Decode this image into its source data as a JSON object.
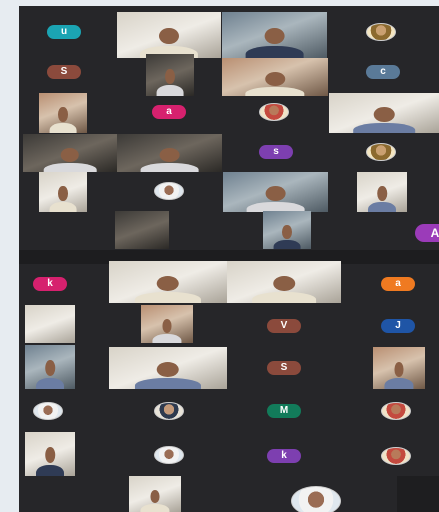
{
  "colors": {
    "background": "#e7ecf1",
    "grid": "#262629",
    "teal": "#1ba4b3",
    "brown": "#8b4a3c",
    "slate": "#5a7a98",
    "pink": "#d6216e",
    "purple": "#7d3fb0",
    "orange": "#ef7a21",
    "blue": "#1f55a6",
    "green": "#127b5a",
    "violet": "#9b3bb9"
  },
  "avatars": {
    "u": "u",
    "s1": "S",
    "c": "c",
    "a1": "a",
    "s2": "s",
    "a_big": "A",
    "k1": "k",
    "a2": "a",
    "v": "V",
    "j": "J",
    "s3": "S",
    "m": "M",
    "k2": "k"
  }
}
